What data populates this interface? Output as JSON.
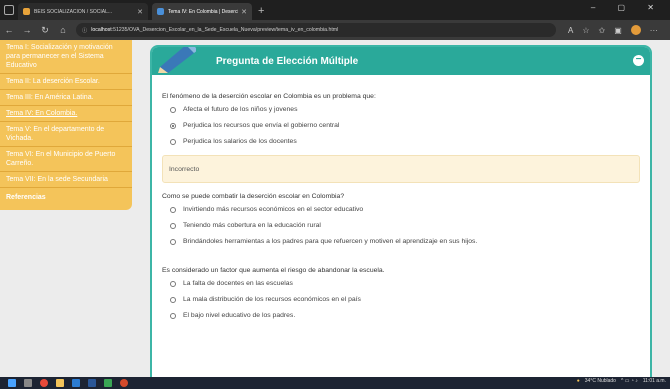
{
  "browser": {
    "tabs": [
      {
        "title": "BEIS SOCIALIZACION / SOCIAL...",
        "active": false
      },
      {
        "title": "Tema IV: En Colombia | Desercio...",
        "active": true
      }
    ],
    "url_host": "localhost",
    "url_rest": ":51235/OVA_Desercion_Escolar_en_la_Sede_Escuela_Nueva/preview/tema_iv_en_colombia.html"
  },
  "sidebar": {
    "items": [
      {
        "label": "Tema I: Socialización y motivación para permanecer en el Sistema Educativo"
      },
      {
        "label": "Tema II: La deserción Escolar."
      },
      {
        "label": "Tema III: En América Latina."
      },
      {
        "label": "Tema IV: En Colombia."
      },
      {
        "label": "Tema V: En el departamento de Vichada."
      },
      {
        "label": "Tema VI: En el Municipio de Puerto Carreño."
      },
      {
        "label": "Tema VII: En la sede Secundaria"
      },
      {
        "label": "Referencias"
      }
    ]
  },
  "quiz": {
    "title": "Pregunta de Elección Múltiple",
    "q1": {
      "text": "El fenómeno de la deserción escolar en Colombia es un problema que:",
      "options": [
        "Afecta el futuro de los niños y jovenes",
        "Perjudica los recursos que envía el gobierno central",
        "Perjudica los salarios de los docentes"
      ]
    },
    "feedback": "Incorrecto",
    "q2": {
      "text": "Como se puede combatir la deserción escolar en Colombia?",
      "options": [
        "Invirtiendo más recursos económicos en el sector educativo",
        "Teniendo más cobertura en la educación rural",
        "Brindándoles herramientas a los padres para que refuercen y motiven el aprendizaje en sus hijos."
      ]
    },
    "q3": {
      "text": "Es considerado un factor que aumenta el riesgo de abandonar la escuela.",
      "options": [
        "La falta de docentes en las escuelas",
        "La mala distribución de los recursos económicos en el país",
        "El bajo nivel educativo de los padres."
      ]
    }
  },
  "taskbar": {
    "weather": "34°C Nublado",
    "time": "11:01 a.m."
  }
}
